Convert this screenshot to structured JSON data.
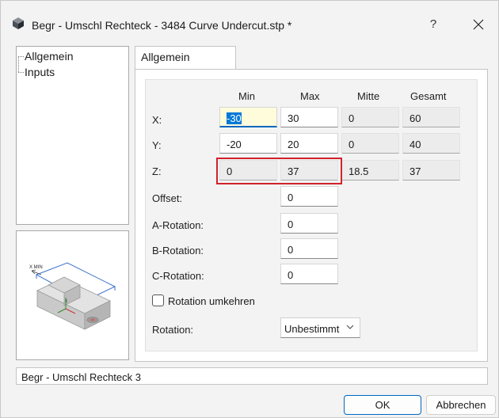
{
  "window": {
    "title": "Begr - Umschl Rechteck - 3484 Curve Undercut.stp *",
    "help_label": "?"
  },
  "tree": {
    "items": [
      {
        "label": "Allgemein"
      },
      {
        "label": "Inputs"
      }
    ]
  },
  "preview": {
    "axis_label": "X MIN"
  },
  "tab": {
    "label": "Allgemein"
  },
  "grid": {
    "headers": {
      "min": "Min",
      "max": "Max",
      "mitte": "Mitte",
      "gesamt": "Gesamt"
    },
    "rows": [
      {
        "label": "X:",
        "min": "-30",
        "max": "30",
        "mitte": "0",
        "gesamt": "60"
      },
      {
        "label": "Y:",
        "min": "-20",
        "max": "20",
        "mitte": "0",
        "gesamt": "40"
      },
      {
        "label": "Z:",
        "min": "0",
        "max": "37",
        "mitte": "18.5",
        "gesamt": "37"
      }
    ],
    "offset": {
      "label": "Offset:",
      "value": "0"
    },
    "a_rotation": {
      "label": "A-Rotation:",
      "value": "0"
    },
    "b_rotation": {
      "label": "B-Rotation:",
      "value": "0"
    },
    "c_rotation": {
      "label": "C-Rotation:",
      "value": "0"
    }
  },
  "rotation_reverse": {
    "label": "Rotation umkehren",
    "checked": false
  },
  "rotation": {
    "label": "Rotation:",
    "value": "Unbestimmt"
  },
  "name_field": {
    "value": "Begr - Umschl Rechteck 3"
  },
  "buttons": {
    "ok": "OK",
    "cancel": "Abbrechen"
  },
  "colors": {
    "accent": "#0067c0",
    "highlight": "#d2222a",
    "focus_bg": "#fffcdc"
  }
}
